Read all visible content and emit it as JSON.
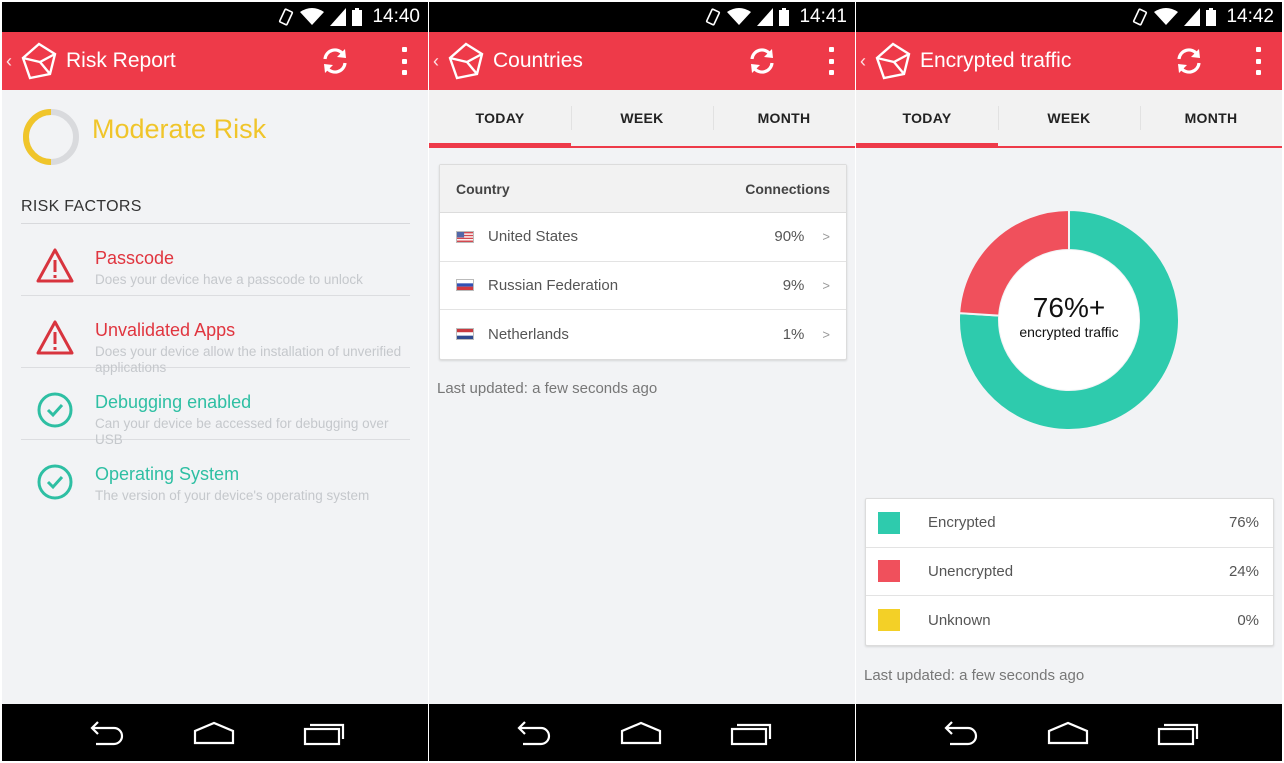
{
  "colors": {
    "accent": "#ee3a49",
    "teal": "#2ecbad",
    "red": "#f0505c",
    "yellow": "#f3d027",
    "moderate": "#f0c52a"
  },
  "screen1": {
    "time": "14:40",
    "title": "Risk Report",
    "risk_level": "Moderate Risk",
    "risk_gauge_fraction": 0.5,
    "section_label": "RISK FACTORS",
    "factors": [
      {
        "name": "Passcode",
        "desc": "Does your device have a passcode to unlock",
        "status": "warning",
        "icon": "warning-icon"
      },
      {
        "name": "Unvalidated Apps",
        "desc": "Does your device allow the installation of unverified applications",
        "status": "warning",
        "icon": "warning-icon"
      },
      {
        "name": "Debugging enabled",
        "desc": "Can your device be accessed for debugging over USB",
        "status": "ok",
        "icon": "check-circle-icon"
      },
      {
        "name": "Operating System",
        "desc": "The version of your device's operating system",
        "status": "ok",
        "icon": "check-circle-icon"
      }
    ]
  },
  "screen2": {
    "time": "14:41",
    "title": "Countries",
    "tabs": [
      "TODAY",
      "WEEK",
      "MONTH"
    ],
    "active_tab": 0,
    "table": {
      "col_country": "Country",
      "col_connections": "Connections",
      "rows": [
        {
          "country": "United States",
          "pct": "90%",
          "chevron": ">",
          "flag": "us-flag-icon"
        },
        {
          "country": "Russian Federation",
          "pct": "9%",
          "chevron": ">",
          "flag": "ru-flag-icon"
        },
        {
          "country": "Netherlands",
          "pct": "1%",
          "chevron": ">",
          "flag": "nl-flag-icon"
        }
      ]
    },
    "updated": "Last updated: a few seconds ago"
  },
  "screen3": {
    "time": "14:42",
    "title": "Encrypted traffic",
    "tabs": [
      "TODAY",
      "WEEK",
      "MONTH"
    ],
    "active_tab": 0,
    "donut_value": "76%+",
    "donut_caption": "encrypted traffic",
    "legend": [
      {
        "name": "Encrypted",
        "pct": "76%",
        "color": "#2ecbad",
        "value": 76
      },
      {
        "name": "Unencrypted",
        "pct": "24%",
        "color": "#f0505c",
        "value": 24
      },
      {
        "name": "Unknown",
        "pct": "0%",
        "color": "#f3d027",
        "value": 0
      }
    ],
    "updated": "Last updated: a few seconds ago"
  }
}
